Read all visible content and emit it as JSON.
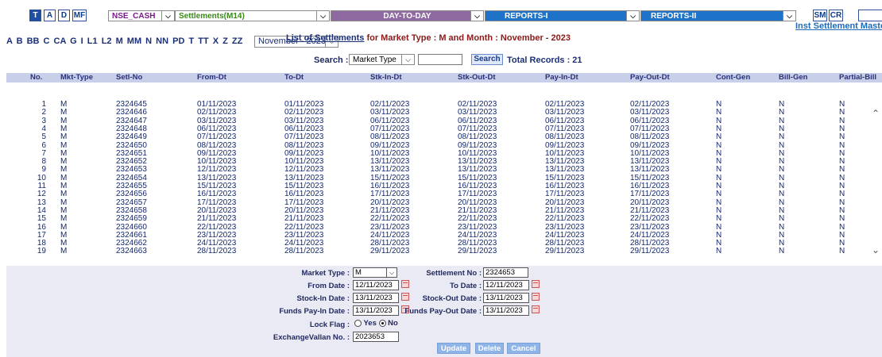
{
  "topbar": {
    "buttons": [
      {
        "label": "T",
        "active": true
      },
      {
        "label": "A",
        "active": false
      },
      {
        "label": "D",
        "active": false
      },
      {
        "label": "MF",
        "active": false
      }
    ],
    "exchange_select": "NSE_CASH",
    "settlement_select": "Settlements(M14)",
    "day_menu": "DAY-TO-DAY",
    "reports1_menu": "REPORTS-I",
    "reports2_menu": "REPORTS-II",
    "sm_label": "SM",
    "cr_label": "CR",
    "inst_link": "Inst Settlement Maste"
  },
  "letters_row": "A B BB C CA G I L1 L2 M MM N NN PD T TT X Z ZZ",
  "month_select": "November - 2023",
  "title": {
    "prefix": "List of Settlements",
    "suffix": " for Market Type : M and Month : November - 2023"
  },
  "search": {
    "label": "Search :",
    "field": "Market Type",
    "button": "Search",
    "records": "Total Records : 21"
  },
  "table": {
    "headers": [
      "No.",
      "Mkt-Type",
      "Setl-No",
      "From-Dt",
      "To-Dt",
      "Stk-In-Dt",
      "Stk-Out-Dt",
      "Pay-In-Dt",
      "Pay-Out-Dt",
      "Cont-Gen",
      "Bill-Gen",
      "Partial-Bill"
    ],
    "rows": [
      [
        "1",
        "M",
        "2324645",
        "01/11/2023",
        "01/11/2023",
        "02/11/2023",
        "02/11/2023",
        "02/11/2023",
        "02/11/2023",
        "N",
        "N",
        "N"
      ],
      [
        "2",
        "M",
        "2324646",
        "02/11/2023",
        "02/11/2023",
        "03/11/2023",
        "03/11/2023",
        "03/11/2023",
        "03/11/2023",
        "N",
        "N",
        "N"
      ],
      [
        "3",
        "M",
        "2324647",
        "03/11/2023",
        "03/11/2023",
        "06/11/2023",
        "06/11/2023",
        "06/11/2023",
        "06/11/2023",
        "N",
        "N",
        "N"
      ],
      [
        "4",
        "M",
        "2324648",
        "06/11/2023",
        "06/11/2023",
        "07/11/2023",
        "07/11/2023",
        "07/11/2023",
        "07/11/2023",
        "N",
        "N",
        "N"
      ],
      [
        "5",
        "M",
        "2324649",
        "07/11/2023",
        "07/11/2023",
        "08/11/2023",
        "08/11/2023",
        "08/11/2023",
        "08/11/2023",
        "N",
        "N",
        "N"
      ],
      [
        "6",
        "M",
        "2324650",
        "08/11/2023",
        "08/11/2023",
        "09/11/2023",
        "09/11/2023",
        "09/11/2023",
        "09/11/2023",
        "N",
        "N",
        "N"
      ],
      [
        "7",
        "M",
        "2324651",
        "09/11/2023",
        "09/11/2023",
        "10/11/2023",
        "10/11/2023",
        "10/11/2023",
        "10/11/2023",
        "N",
        "N",
        "N"
      ],
      [
        "8",
        "M",
        "2324652",
        "10/11/2023",
        "10/11/2023",
        "13/11/2023",
        "13/11/2023",
        "13/11/2023",
        "13/11/2023",
        "N",
        "N",
        "N"
      ],
      [
        "9",
        "M",
        "2324653",
        "12/11/2023",
        "12/11/2023",
        "13/11/2023",
        "13/11/2023",
        "13/11/2023",
        "13/11/2023",
        "N",
        "N",
        "N"
      ],
      [
        "10",
        "M",
        "2324654",
        "13/11/2023",
        "13/11/2023",
        "15/11/2023",
        "15/11/2023",
        "15/11/2023",
        "15/11/2023",
        "N",
        "N",
        "N"
      ],
      [
        "11",
        "M",
        "2324655",
        "15/11/2023",
        "15/11/2023",
        "16/11/2023",
        "16/11/2023",
        "16/11/2023",
        "16/11/2023",
        "N",
        "N",
        "N"
      ],
      [
        "12",
        "M",
        "2324656",
        "16/11/2023",
        "16/11/2023",
        "17/11/2023",
        "17/11/2023",
        "17/11/2023",
        "17/11/2023",
        "N",
        "N",
        "N"
      ],
      [
        "13",
        "M",
        "2324657",
        "17/11/2023",
        "17/11/2023",
        "20/11/2023",
        "20/11/2023",
        "20/11/2023",
        "20/11/2023",
        "N",
        "N",
        "N"
      ],
      [
        "14",
        "M",
        "2324658",
        "20/11/2023",
        "20/11/2023",
        "21/11/2023",
        "21/11/2023",
        "21/11/2023",
        "21/11/2023",
        "N",
        "N",
        "N"
      ],
      [
        "15",
        "M",
        "2324659",
        "21/11/2023",
        "21/11/2023",
        "22/11/2023",
        "22/11/2023",
        "22/11/2023",
        "22/11/2023",
        "N",
        "N",
        "N"
      ],
      [
        "16",
        "M",
        "2324660",
        "22/11/2023",
        "22/11/2023",
        "23/11/2023",
        "23/11/2023",
        "23/11/2023",
        "23/11/2023",
        "N",
        "N",
        "N"
      ],
      [
        "17",
        "M",
        "2324661",
        "23/11/2023",
        "23/11/2023",
        "24/11/2023",
        "24/11/2023",
        "24/11/2023",
        "24/11/2023",
        "N",
        "N",
        "N"
      ],
      [
        "18",
        "M",
        "2324662",
        "24/11/2023",
        "24/11/2023",
        "28/11/2023",
        "28/11/2023",
        "28/11/2023",
        "28/11/2023",
        "N",
        "N",
        "N"
      ],
      [
        "19",
        "M",
        "2324663",
        "28/11/2023",
        "28/11/2023",
        "29/11/2023",
        "29/11/2023",
        "29/11/2023",
        "29/11/2023",
        "N",
        "N",
        "N"
      ]
    ]
  },
  "form": {
    "market_type_label": "Market Type :",
    "market_type_value": "M",
    "settlement_no_label": "Settlement No :",
    "settlement_no_value": "2324653",
    "from_date_label": "From Date :",
    "from_date_value": "12/11/2023",
    "to_date_label": "To Date :",
    "to_date_value": "12/11/2023",
    "stock_in_label": "Stock-In Date :",
    "stock_in_value": "13/11/2023",
    "stock_out_label": "Stock-Out Date :",
    "stock_out_value": "13/11/2023",
    "funds_payin_label": "Funds Pay-In Date :",
    "funds_payin_value": "13/11/2023",
    "funds_payout_label": "Funds Pay-Out Date :",
    "funds_payout_value": "13/11/2023",
    "lock_flag_label": "Lock Flag :",
    "lock_yes": "Yes",
    "lock_no": "No",
    "vallan_label": "ExchangeVallan No. :",
    "vallan_value": "2023653",
    "update_btn": "Update",
    "delete_btn": "Delete",
    "cancel_btn": "Cancel"
  },
  "colors": {
    "header_bg": "#c8cfe8",
    "form_bg": "#eaeaf4",
    "menu_day": "#8e6aa0",
    "menu_reports": "#1e73c8",
    "button_bg": "#8fb4e8"
  }
}
